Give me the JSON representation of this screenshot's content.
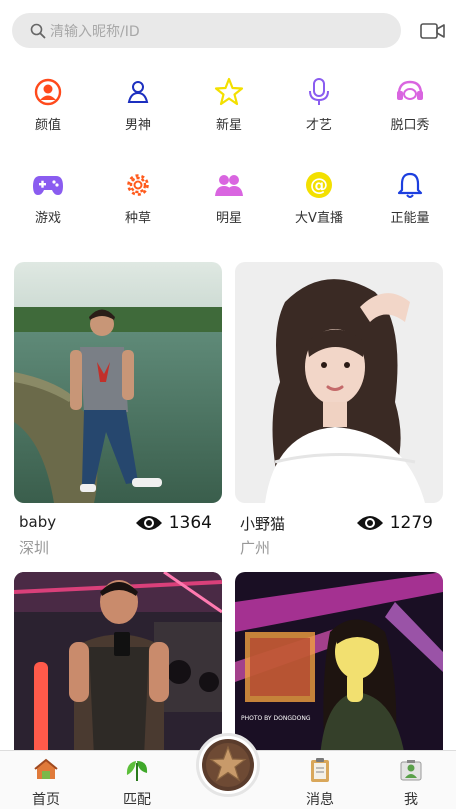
{
  "search": {
    "placeholder": "清输入昵称/ID"
  },
  "categories": [
    {
      "label": "颜值",
      "icon": "person-circle-icon",
      "color": "#ff4a1c"
    },
    {
      "label": "男神",
      "icon": "person-icon",
      "color": "#1c2fbf"
    },
    {
      "label": "新星",
      "icon": "star-icon",
      "color": "#f3e000"
    },
    {
      "label": "才艺",
      "icon": "microphone-icon",
      "color": "#8a5cf0"
    },
    {
      "label": "脱口秀",
      "icon": "headset-icon",
      "color": "#d965e0"
    },
    {
      "label": "游戏",
      "icon": "gamepad-icon",
      "color": "#8a5cf0"
    },
    {
      "label": "种草",
      "icon": "gear-icon",
      "color": "#ff5a1c"
    },
    {
      "label": "明星",
      "icon": "people-icon",
      "color": "#d965e0"
    },
    {
      "label": "大V直播",
      "icon": "at-icon",
      "color": "#f3e000"
    },
    {
      "label": "正能量",
      "icon": "bell-icon",
      "color": "#1c3fdf"
    }
  ],
  "cards": [
    {
      "name": "baby",
      "city": "深圳",
      "views": "1364"
    },
    {
      "name": "小野猫",
      "city": "广州",
      "views": "1279"
    },
    {
      "name": "",
      "city": "",
      "views": ""
    },
    {
      "name": "",
      "city": "",
      "views": ""
    }
  ],
  "photo_caption": "PHOTO BY DONGDONG",
  "nav": {
    "home": "首页",
    "match": "匹配",
    "messages": "消息",
    "me": "我"
  }
}
